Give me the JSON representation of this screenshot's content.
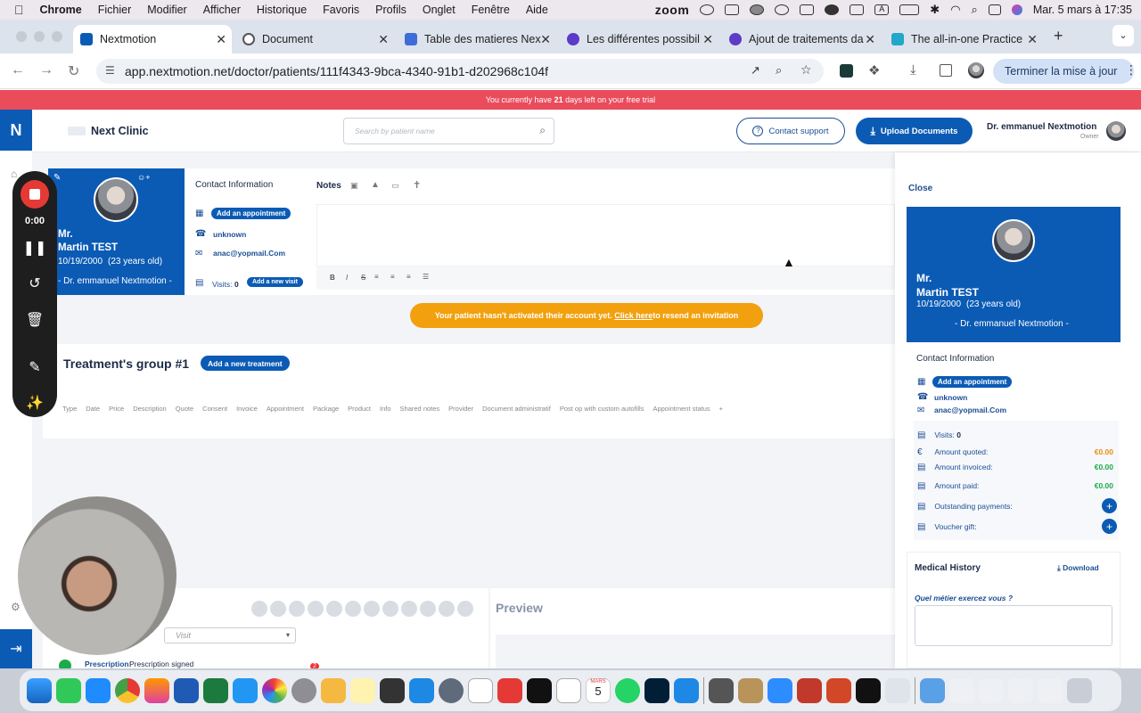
{
  "menubar": {
    "apple": "",
    "app_name": "Chrome",
    "menus": [
      "Fichier",
      "Modifier",
      "Afficher",
      "Historique",
      "Favoris",
      "Profils",
      "Onglet",
      "Fenêtre",
      "Aide"
    ],
    "status_zoom": "zoom",
    "clock": "Mar. 5 mars à 17:35"
  },
  "tabs": [
    {
      "title": "Nextmotion",
      "color": "#0b5bb5"
    },
    {
      "title": "Document",
      "color": "#8a8f98"
    },
    {
      "title": "Table des matieres Nex",
      "color": "#3d6ed8"
    },
    {
      "title": "Les différentes possibil",
      "color": "#5b3bc7"
    },
    {
      "title": "Ajout de traitements da",
      "color": "#5b3bc7"
    },
    {
      "title": "The all-in-one Practice",
      "color": "#22a7c9"
    }
  ],
  "address": {
    "url": "app.nextmotion.net/doctor/patients/111f4343-9bca-4340-91b1-d202968c104f",
    "finish_label": "Terminer la mise à jour"
  },
  "trial_banner": {
    "prefix": "You currently have ",
    "days": "21",
    "suffix": " days left on your free trial"
  },
  "header": {
    "logo_letter": "N",
    "clinic_name": "Next Clinic",
    "search_placeholder": "Search by patient name",
    "contact_support": "Contact support",
    "upload_documents": "Upload Documents",
    "doctor_name": "Dr. emmanuel Nextmotion",
    "role": "Owner"
  },
  "patient": {
    "title": "Mr.",
    "name": "Martin TEST",
    "dob": "10/19/2000",
    "age": "(23 years old)",
    "doctor": "- Dr. emmanuel Nextmotion -"
  },
  "contact": {
    "heading": "Contact Information",
    "add_appointment": "Add an appointment",
    "phone": "unknown",
    "email": "anac@yopmail.Com",
    "visits_label": "Visits:",
    "visits_value": "0",
    "add_visit": "Add a new visit"
  },
  "notes": {
    "heading": "Notes",
    "format_bold": "B",
    "format_italic": "I",
    "format_strike": "S"
  },
  "activation_banner": {
    "text": "Your patient hasn't activated their account yet. ",
    "link": "Click here",
    "suffix": " to resend an invitation"
  },
  "treatments": {
    "title": "Treatment's group #1",
    "add_button": "Add a new treatment",
    "columns": [
      "Type",
      "Date",
      "Price",
      "Description",
      "Quote",
      "Consent",
      "Invoice",
      "Appointment",
      "Package",
      "Product",
      "Info",
      "Shared notes",
      "Provider",
      "Document administratif",
      "Post op with custom autofills",
      "Appointment status",
      "+"
    ]
  },
  "lower": {
    "visit_placeholder": "Visit",
    "preview": "Preview",
    "prescription_label": "Prescription:",
    "prescription_value": "Prescription signed",
    "badge_count": "2"
  },
  "right_panel": {
    "close": "Close",
    "title": "Mr.",
    "name": "Martin TEST",
    "dob": "10/19/2000",
    "age": "(23 years old)",
    "doctor": "- Dr. emmanuel Nextmotion -",
    "contact_heading": "Contact Information",
    "add_appointment": "Add an appointment",
    "phone": "unknown",
    "email": "anac@yopmail.Com",
    "visits_label": "Visits:",
    "visits_value": "0",
    "quoted_label": "Amount quoted:",
    "quoted_value": "€0.00",
    "invoiced_label": "Amount invoiced:",
    "invoiced_value": "€0.00",
    "paid_label": "Amount paid:",
    "paid_value": "€0.00",
    "outstanding_label": "Outstanding payments:",
    "voucher_label": "Voucher gift:",
    "medical_history": "Medical History",
    "download": "Download",
    "question": "Quel métier exercez vous ?"
  },
  "recorder": {
    "timer": "0:00"
  },
  "dock": {
    "calendar_month": "MARS",
    "calendar_day": "5"
  },
  "colors": {
    "brand": "#0b5bb5",
    "trial": "#ea4c5b",
    "warning": "#f2a00d",
    "positive": "#1bab4a"
  }
}
